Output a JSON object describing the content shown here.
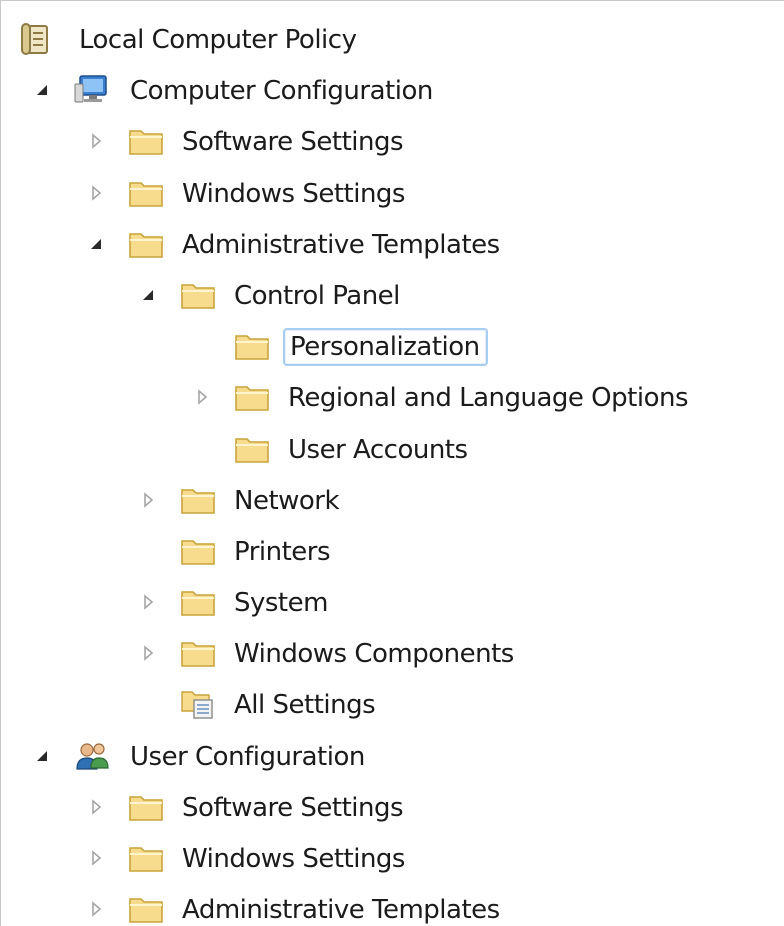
{
  "tree": {
    "root": {
      "label": "Local Computer Policy",
      "icon": "policy-document-icon"
    },
    "nodes": [
      {
        "id": "computer-configuration",
        "label": "Computer Configuration",
        "level": 1,
        "expander": "expanded",
        "icon": "computer-icon"
      },
      {
        "id": "cc-software-settings",
        "label": "Software Settings",
        "level": 2,
        "expander": "collapsed",
        "icon": "folder-icon"
      },
      {
        "id": "cc-windows-settings",
        "label": "Windows Settings",
        "level": 2,
        "expander": "collapsed",
        "icon": "folder-icon"
      },
      {
        "id": "cc-administrative-templates",
        "label": "Administrative Templates",
        "level": 2,
        "expander": "expanded",
        "icon": "folder-icon"
      },
      {
        "id": "control-panel",
        "label": "Control Panel",
        "level": 3,
        "expander": "expanded",
        "icon": "folder-icon"
      },
      {
        "id": "personalization",
        "label": "Personalization",
        "level": 4,
        "expander": "none",
        "icon": "folder-icon",
        "selected": true
      },
      {
        "id": "regional-and-language-options",
        "label": "Regional and Language Options",
        "level": 4,
        "expander": "collapsed",
        "icon": "folder-icon"
      },
      {
        "id": "user-accounts",
        "label": "User Accounts",
        "level": 4,
        "expander": "none",
        "icon": "folder-icon"
      },
      {
        "id": "network",
        "label": "Network",
        "level": 3,
        "expander": "collapsed",
        "icon": "folder-icon"
      },
      {
        "id": "printers",
        "label": "Printers",
        "level": 3,
        "expander": "none",
        "icon": "folder-icon"
      },
      {
        "id": "system",
        "label": "System",
        "level": 3,
        "expander": "collapsed",
        "icon": "folder-icon"
      },
      {
        "id": "windows-components",
        "label": "Windows Components",
        "level": 3,
        "expander": "collapsed",
        "icon": "folder-icon"
      },
      {
        "id": "all-settings",
        "label": "All Settings",
        "level": 3,
        "expander": "none",
        "icon": "all-settings-icon"
      },
      {
        "id": "user-configuration",
        "label": "User Configuration",
        "level": 1,
        "expander": "expanded",
        "icon": "user-icon"
      },
      {
        "id": "uc-software-settings",
        "label": "Software Settings",
        "level": 2,
        "expander": "collapsed",
        "icon": "folder-icon"
      },
      {
        "id": "uc-windows-settings",
        "label": "Windows Settings",
        "level": 2,
        "expander": "collapsed",
        "icon": "folder-icon"
      },
      {
        "id": "uc-administrative-templates",
        "label": "Administrative Templates",
        "level": 2,
        "expander": "collapsed",
        "icon": "folder-icon"
      }
    ]
  },
  "colors": {
    "folder": "#f6dc8c",
    "folder_edge": "#c9a43c",
    "selection_border": "#a7cdf0",
    "expander_collapsed": "#a6a6a6",
    "expander_expanded": "#2a2a2a",
    "text": "#1b1b1b"
  }
}
